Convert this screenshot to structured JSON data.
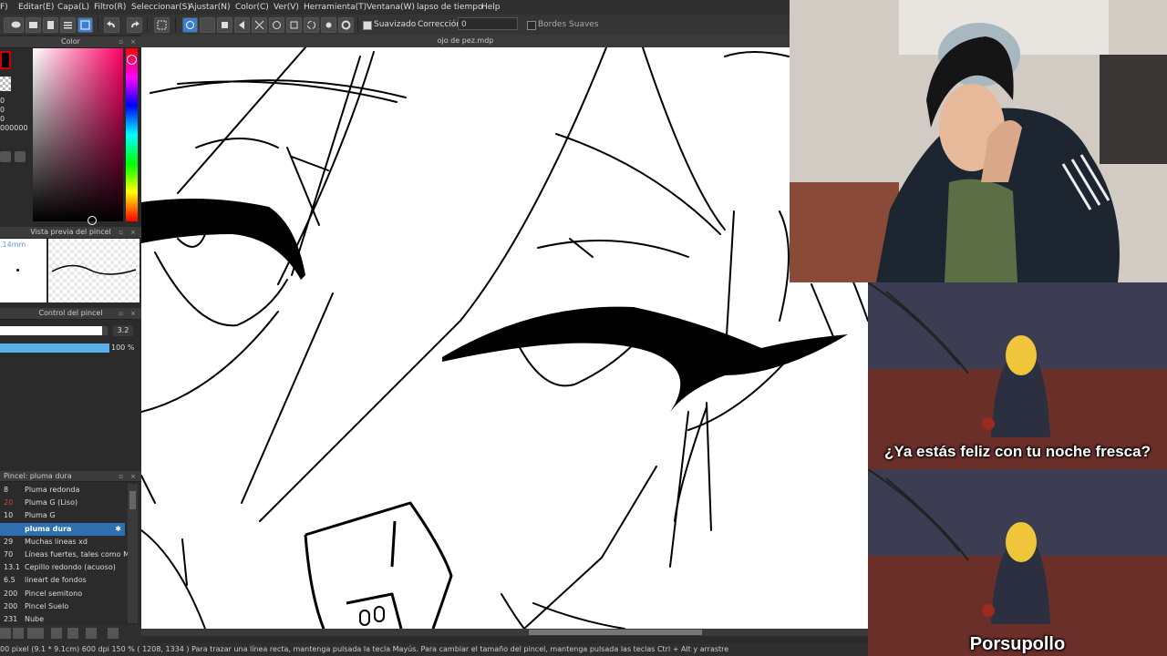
{
  "menu": [
    "F)",
    "Editar(E)",
    "Capa(L)",
    "Filtro(R)",
    "Seleccionar(S)",
    "Ajustar(N)",
    "Color(C)",
    "Ver(V)",
    "Herramienta(T)",
    "Ventana(W)",
    "lapso de tiempo",
    "Help"
  ],
  "toolbar": {
    "smooth_label": "Suavizado",
    "correction_label": "Corrección",
    "correction_value": "0",
    "soft_edges_label": "Bordes Suaves"
  },
  "color_panel": {
    "title": "Color",
    "values": [
      "0",
      "0",
      "0",
      "000000"
    ]
  },
  "brush_preview": {
    "title": "Vista previa del pincel",
    "size": ".14mm"
  },
  "brush_control": {
    "title": "Control del pincel",
    "size_value": "3.2",
    "opacity_value": "100 %",
    "opacity_fraction": 1.0,
    "size_fraction": 0.95
  },
  "brush_list": {
    "title": "Pincel: pluma dura",
    "items": [
      {
        "num": "8",
        "name": "Pluma redonda"
      },
      {
        "num": "20",
        "name": "Pluma G (Liso)"
      },
      {
        "num": "10",
        "name": "Pluma G"
      },
      {
        "num": "",
        "name": "pluma dura",
        "selected": true
      },
      {
        "num": "29",
        "name": "Muchas lineas xd"
      },
      {
        "num": "70",
        "name": "Líneas fuertes, tales como Ma"
      },
      {
        "num": "13.1",
        "name": "Cepillo redondo (acuoso)"
      },
      {
        "num": "6.5",
        "name": "lineart de fondos"
      },
      {
        "num": "200",
        "name": "Pincel semitono"
      },
      {
        "num": "200",
        "name": "Pincel Suelo"
      },
      {
        "num": "231",
        "name": "Nube"
      }
    ]
  },
  "canvas": {
    "title": "ojo de pez.mdp"
  },
  "status": {
    "text": "00 pixel   (9.1 * 9.1cm)  600 dpi   150 %   ( 1208, 1334 )   Para trazar una línea recta, mantenga pulsada la tecla Mayús. Para cambiar el tamaño del pincel, mantenga pulsada las teclas Ctrl + Alt y arrastre"
  },
  "meme": {
    "caption_top": "¿Ya estás feliz con tu noche fresca?",
    "caption_bottom": "Porsupollo"
  },
  "colors": {
    "accent": "#3a7fd0",
    "panel_bg": "#2b2b2b",
    "selected_row": "#2e6fb0"
  }
}
